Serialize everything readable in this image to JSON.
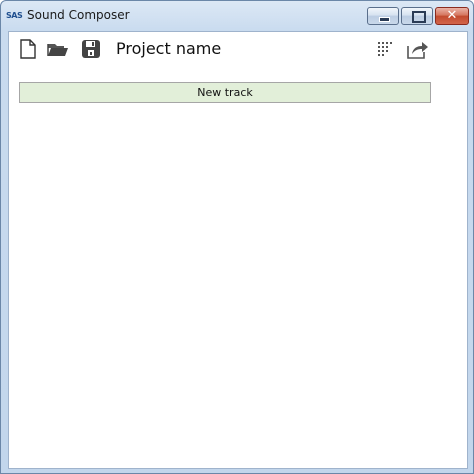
{
  "window": {
    "title": "Sound Composer",
    "app_icon_text": "SAS",
    "controls": {
      "minimize": "minimize",
      "maximize": "maximize",
      "close": "✕"
    }
  },
  "toolbar": {
    "project_name": "Project name",
    "icons": [
      "new-file-icon",
      "open-folder-icon",
      "save-icon",
      "grid-icon",
      "export-icon"
    ]
  },
  "main": {
    "new_track_label": "New track"
  }
}
